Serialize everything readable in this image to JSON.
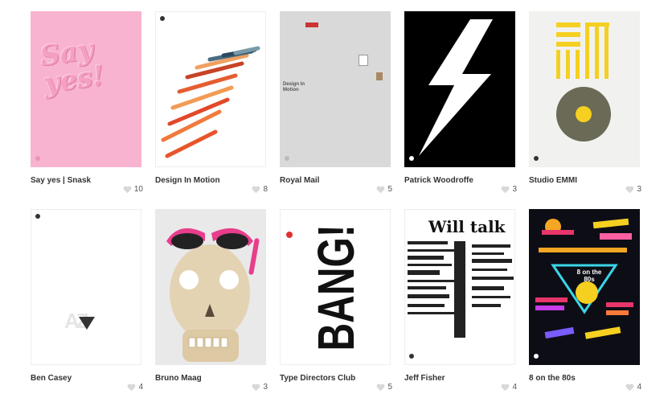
{
  "posters": [
    {
      "title": "Say yes | Snask",
      "likes": "10",
      "art_text": "Say yes!"
    },
    {
      "title": "Design In Motion",
      "likes": "8"
    },
    {
      "title": "Royal Mail",
      "likes": "5",
      "art_text": "Design In Motion"
    },
    {
      "title": "Patrick Woodroffe",
      "likes": "3"
    },
    {
      "title": "Studio EMMI",
      "likes": "3"
    },
    {
      "title": "Ben Casey",
      "likes": "4",
      "art_text": "AZ"
    },
    {
      "title": "Bruno Maag",
      "likes": "3"
    },
    {
      "title": "Type Directors Club",
      "likes": "5",
      "art_text": "BANG!"
    },
    {
      "title": "Jeff Fisher",
      "likes": "4",
      "art_text": "Will talk"
    },
    {
      "title": "8 on the 80s",
      "likes": "4",
      "art_text": "8 on the 80s"
    }
  ],
  "colors": {
    "pink": "#f7b3cf",
    "emmi_yellow": "#f5d020",
    "emmi_olive": "#6b6a56"
  }
}
